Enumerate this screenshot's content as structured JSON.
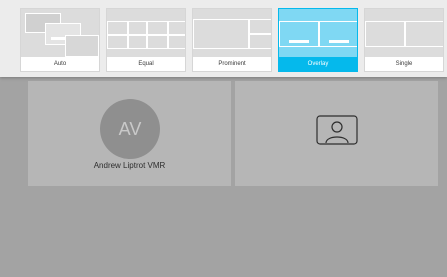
{
  "layouts": [
    {
      "label": "Auto",
      "selected": false
    },
    {
      "label": "Equal",
      "selected": false
    },
    {
      "label": "Prominent",
      "selected": false
    },
    {
      "label": "Overlay",
      "selected": true
    },
    {
      "label": "Single",
      "selected": false
    }
  ],
  "tiles": {
    "participant": {
      "initials": "AV",
      "name": "Andrew Liptrot VMR"
    },
    "self_view": {
      "icon": "person-outline-icon"
    }
  },
  "colors": {
    "accent": "#05b9ec",
    "background": "#a3a3a3",
    "tile": "#b6b6b6",
    "avatar": "#8f8f8f"
  }
}
